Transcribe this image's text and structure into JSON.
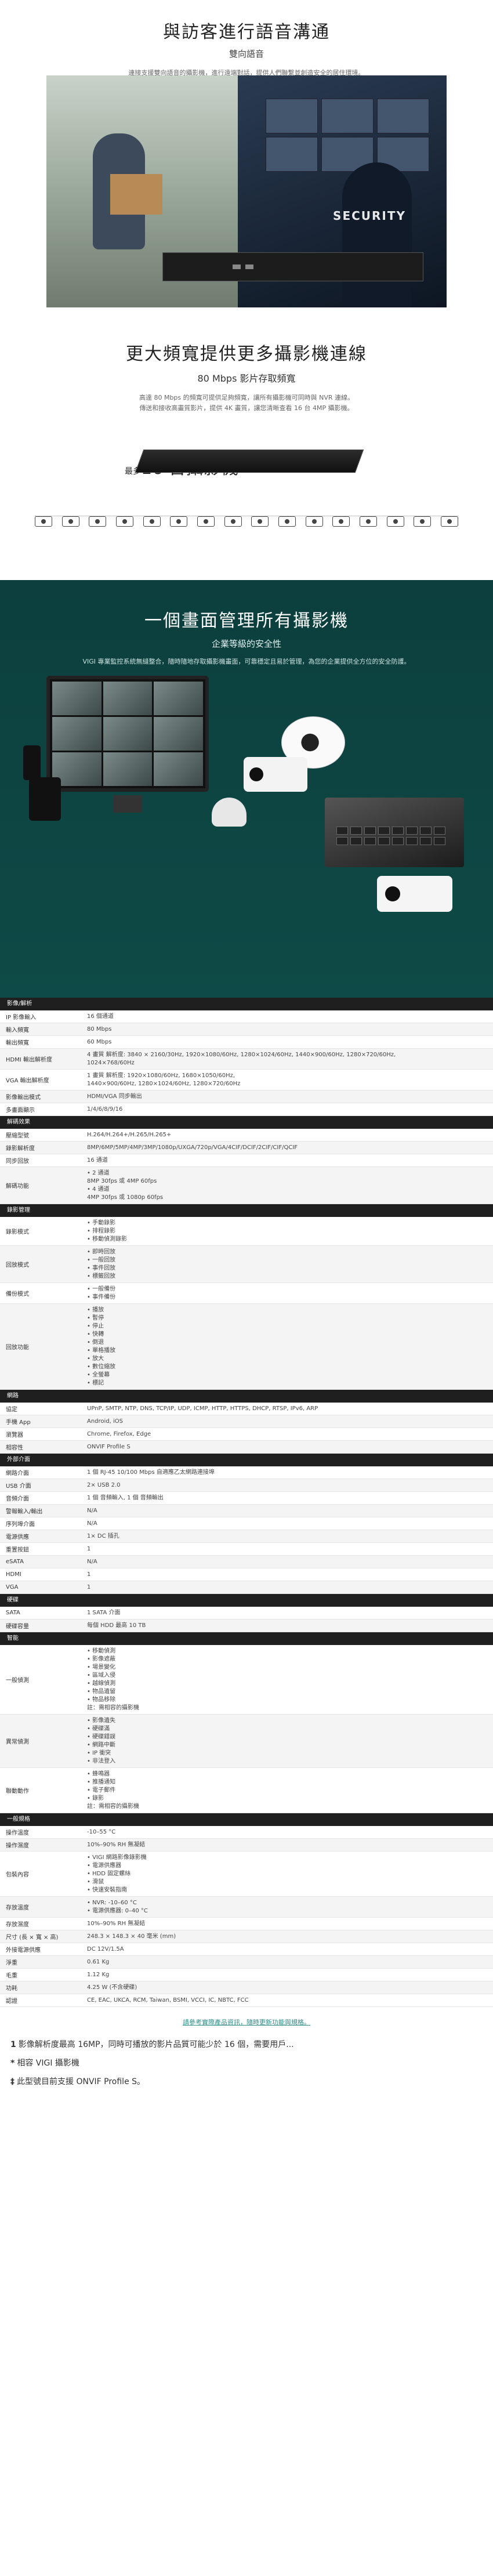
{
  "hero": {
    "title": "與訪客進行語音溝通",
    "subtitle": "雙向語音",
    "desc": "連接支援雙向語音的攝影機，進行遠端對話，提供人們聯繫並創造安全的居住環境。",
    "security_label": "SECURITY"
  },
  "bandwidth": {
    "title": "更大頻寬提供更多攝影機連線",
    "subtitle": "80 Mbps 影片存取頻寬",
    "desc_line1": "高達 80 Mbps 的頻寬可提供足夠頻寬，讓所有攝影機可同時與 NVR 連線。",
    "desc_line2": "傳送和接收高畫質影片，提供 4K 畫質，讓您清晰查看 16 台 4MP 攝影機。",
    "upto": "最多",
    "upto_count": "16 台攝影機"
  },
  "management": {
    "title": "一個畫面管理所有攝影機",
    "subtitle": "企業等級的安全性",
    "desc": "VIGI 專業監控系統無縫整合，隨時隨地存取攝影機畫面，可靠穩定且易於管理，為您的企業提供全方位的安全防護。"
  },
  "spec": [
    {
      "group": "影像/解析",
      "rows": [
        {
          "k": "IP 影像輸入",
          "v": "16 個通道"
        },
        {
          "k": "輸入頻寬",
          "v": "80 Mbps"
        },
        {
          "k": "輸出頻寬",
          "v": "60 Mbps"
        },
        {
          "k": "HDMI 輸出解析度",
          "v": "4 畫質 解析度: 3840 × 2160/30Hz, 1920×1080/60Hz, 1280×1024/60Hz, 1440×900/60Hz, 1280×720/60Hz,\n1024×768/60Hz"
        },
        {
          "k": "VGA 輸出解析度",
          "v": "1 畫質 解析度: 1920×1080/60Hz, 1680×1050/60Hz,\n1440×900/60Hz, 1280×1024/60Hz, 1280×720/60Hz"
        },
        {
          "k": "影像輸出模式",
          "v": "HDMI/VGA 同步輸出"
        },
        {
          "k": "多畫面顯示",
          "v": "1/4/6/8/9/16"
        }
      ]
    },
    {
      "group": "解碼效果",
      "rows": [
        {
          "k": "壓縮型號",
          "v": "H.264/H.264+/H.265/H.265+"
        },
        {
          "k": "錄影解析度",
          "v": "8MP/6MP/5MP/4MP/3MP/1080p/UXGA/720p/VGA/4CIF/DCIF/2CIF/CIF/QCIF"
        },
        {
          "k": "同步回放",
          "v": "16 通道"
        },
        {
          "k": "解碼功能",
          "v": "• 2 通道\n8MP 30fps 或 4MP 60fps\n• 4 通道\n4MP 30fps 或 1080p 60fps"
        }
      ]
    },
    {
      "group": "錄影管理",
      "rows": [
        {
          "k": "錄影模式",
          "v": "• 手動錄影\n• 排程錄影\n• 移動偵測錄影"
        },
        {
          "k": "回放模式",
          "v": "• 即時回放\n• 一般回放\n• 事件回放\n• 標籤回放"
        },
        {
          "k": "備份模式",
          "v": "• 一般備份\n• 事件備份"
        },
        {
          "k": "回放功能",
          "v": "• 播放\n• 暫停\n• 停止\n• 快轉\n• 倒退\n• 單格播放\n• 放大\n• 數位縮放\n• 全螢幕\n• 標記"
        }
      ]
    },
    {
      "group": "網路",
      "rows": [
        {
          "k": "協定",
          "v": "UPnP, SMTP, NTP, DNS, TCP/IP, UDP, ICMP, HTTP, HTTPS, DHCP, RTSP, IPv6, ARP"
        },
        {
          "k": "手機 App",
          "v": "Android, iOS"
        },
        {
          "k": "瀏覽器",
          "v": "Chrome, Firefox, Edge"
        },
        {
          "k": "相容性",
          "v": "ONVIF Profile S"
        }
      ]
    },
    {
      "group": "外部介面",
      "rows": [
        {
          "k": "網路介面",
          "v": "1 個 RJ-45 10/100 Mbps 自適應乙太網路連接埠"
        },
        {
          "k": "USB 介面",
          "v": "2× USB 2.0"
        },
        {
          "k": "音頻介面",
          "v": "1 個 音頻輸入, 1 個 音頻輸出"
        },
        {
          "k": "警報輸入/輸出",
          "v": "N/A"
        },
        {
          "k": "序列埠介面",
          "v": "N/A"
        },
        {
          "k": "電源供應",
          "v": "1× DC 插孔"
        },
        {
          "k": "重置按鈕",
          "v": "1"
        },
        {
          "k": "eSATA",
          "v": "N/A"
        },
        {
          "k": "HDMI",
          "v": "1"
        },
        {
          "k": "VGA",
          "v": "1"
        }
      ]
    },
    {
      "group": "硬碟",
      "rows": [
        {
          "k": "SATA",
          "v": "1 SATA 介面"
        },
        {
          "k": "硬碟容量",
          "v": "每個 HDD 最高 10 TB"
        }
      ]
    },
    {
      "group": "智能",
      "rows": [
        {
          "k": "一般偵測",
          "v": "• 移動偵測\n• 影像遮蔽\n• 場景變化\n• 區域入侵\n• 越線偵測\n• 物品遺留\n• 物品移除\n註：需相容的攝影機"
        },
        {
          "k": "異常偵測",
          "v": "• 影像遺失\n• 硬碟滿\n• 硬碟錯誤\n• 網路中斷\n• IP 衝突\n• 非法登入"
        },
        {
          "k": "聯動動作",
          "v": "• 蜂鳴器\n• 推播通知\n• 電子郵件\n• 錄影\n註：需相容的攝影機"
        }
      ]
    },
    {
      "group": "一般規格",
      "rows": [
        {
          "k": "操作溫度",
          "v": "-10–55 °C"
        },
        {
          "k": "操作濕度",
          "v": "10%–90% RH 無凝結"
        },
        {
          "k": "包裝內容",
          "v": "• VIGI 網路影像錄影機\n• 電源供應器\n• HDD 固定螺絲\n• 滑鼠\n• 快速安裝指南"
        },
        {
          "k": "存放溫度",
          "v": "• NVR: -10–60 °C\n• 電源供應器: 0–40 °C"
        },
        {
          "k": "存放濕度",
          "v": "10%–90% RH 無凝結"
        },
        {
          "k": "尺寸 (長 × 寬 × 高)",
          "v": "248.3 × 148.3 × 40 毫米 (mm)"
        },
        {
          "k": "外接電源供應",
          "v": "DC 12V/1.5A"
        },
        {
          "k": "淨重",
          "v": "0.61 Kg"
        },
        {
          "k": "毛重",
          "v": "1.12 Kg"
        },
        {
          "k": "功耗",
          "v": "4.25 W (不含硬碟)"
        },
        {
          "k": "認證",
          "v": "CE, EAC, UKCA, RCM, Taiwan, BSMI, VCCI, IC, NBTC, FCC"
        }
      ]
    }
  ],
  "footnotes": {
    "center_link": "請參考實際產品資訊，隨時更新功能與規格。",
    "lines": [
      {
        "mark": "1",
        "text": "影像解析度最高 16MP，同時可播放的影片品質可能少於 16 個，需要用戶..."
      },
      {
        "mark": "*",
        "text": "相容 VIGI 攝影機"
      },
      {
        "mark": "‡",
        "text": "此型號目前支援 ONVIF Profile S。"
      }
    ]
  }
}
